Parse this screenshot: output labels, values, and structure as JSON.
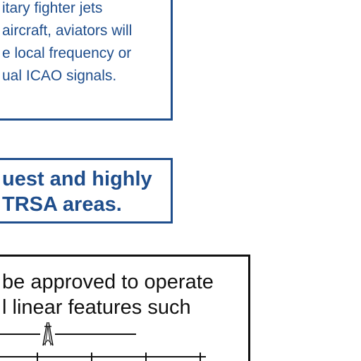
{
  "frequency_box": {
    "lines": [
      "itary fighter jets",
      "aircraft, aviators will",
      "e local frequency or",
      "ual ICAO signals."
    ]
  },
  "trsa_box": {
    "lines": [
      "uest and highly",
      "TRSA areas."
    ]
  },
  "operate_box": {
    "lines": [
      "be approved to operate",
      "l linear features such"
    ]
  },
  "colors": {
    "blue": "#1f4e8c",
    "black": "#111111"
  },
  "icons": [
    "radio-tower-icon"
  ]
}
